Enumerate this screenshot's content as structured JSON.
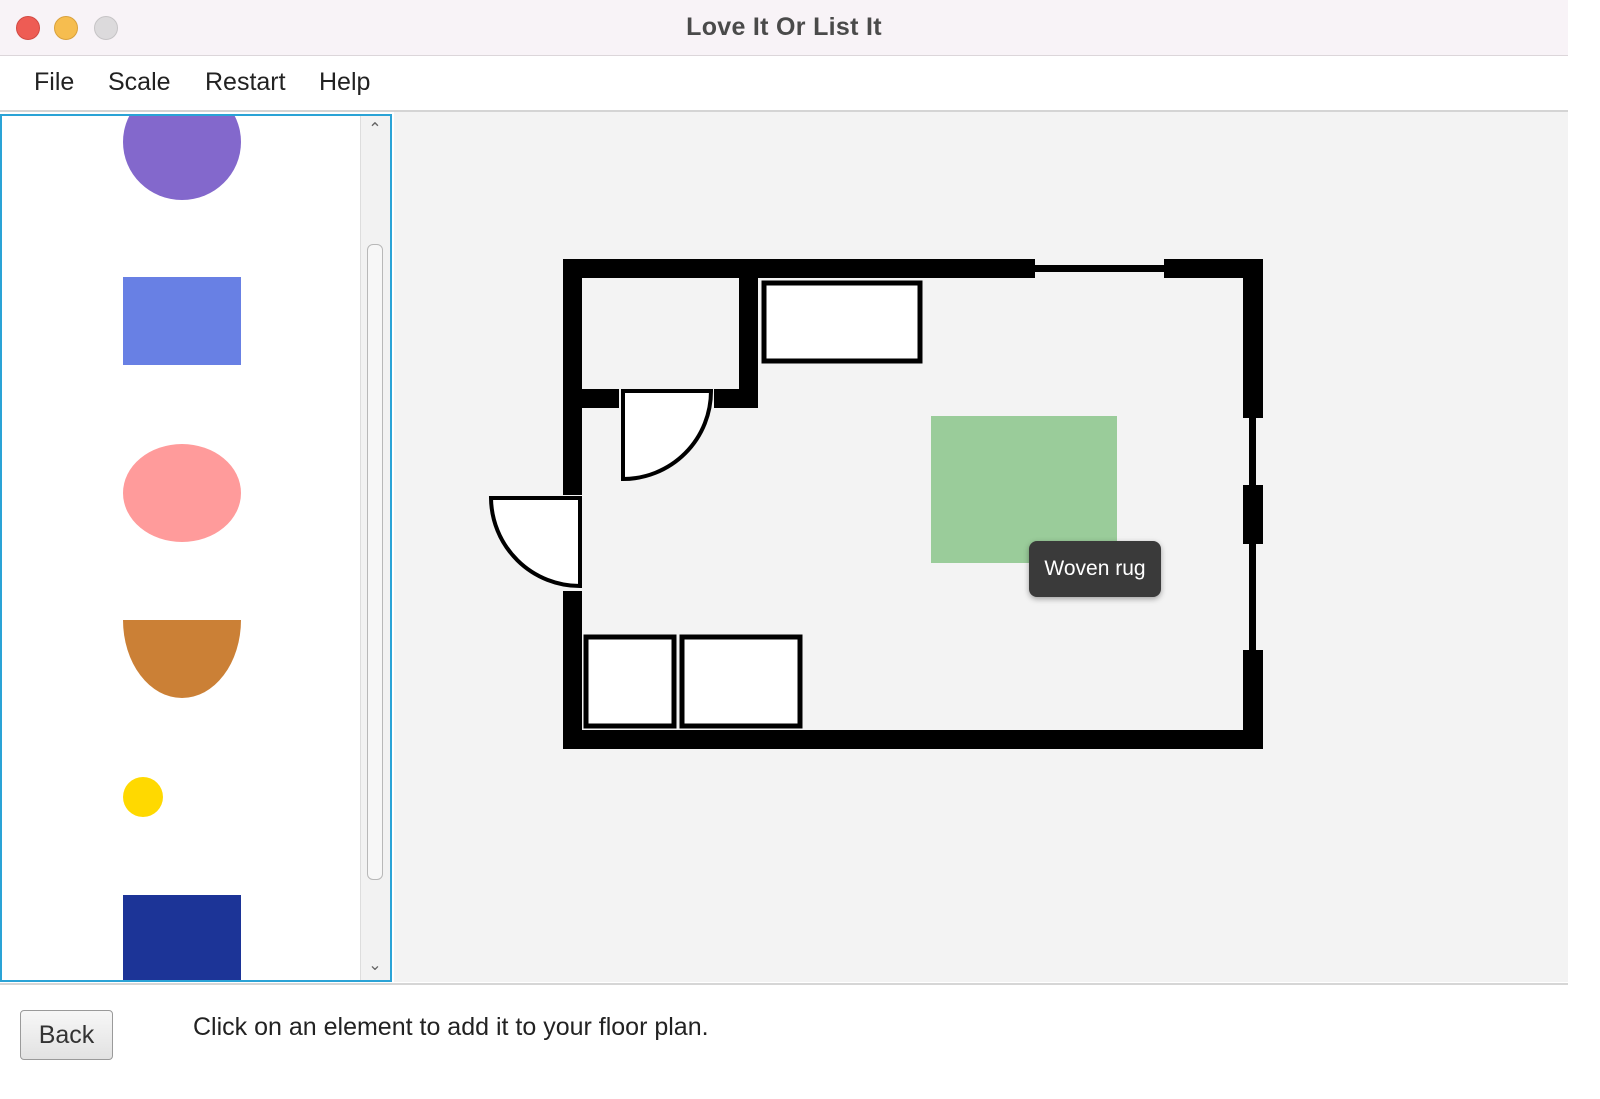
{
  "window": {
    "title": "Love It Or List It"
  },
  "menu": {
    "items": [
      "File",
      "Scale",
      "Restart",
      "Help"
    ]
  },
  "palette": {
    "elements": [
      {
        "shape": "circle",
        "color": "#8368cc"
      },
      {
        "shape": "rectangle",
        "color": "#6880e4"
      },
      {
        "shape": "ellipse",
        "color": "#ff9b9b"
      },
      {
        "shape": "half-ellipse",
        "color": "#cb8036"
      },
      {
        "shape": "small-circle",
        "color": "#ffd900"
      },
      {
        "shape": "rectangle",
        "color": "#1c3497"
      }
    ]
  },
  "floorplan": {
    "rug_color": "#9acc9a",
    "tooltip": "Woven rug"
  },
  "footer": {
    "back_label": "Back",
    "instruction": "Click on an element to add it to your floor plan."
  }
}
